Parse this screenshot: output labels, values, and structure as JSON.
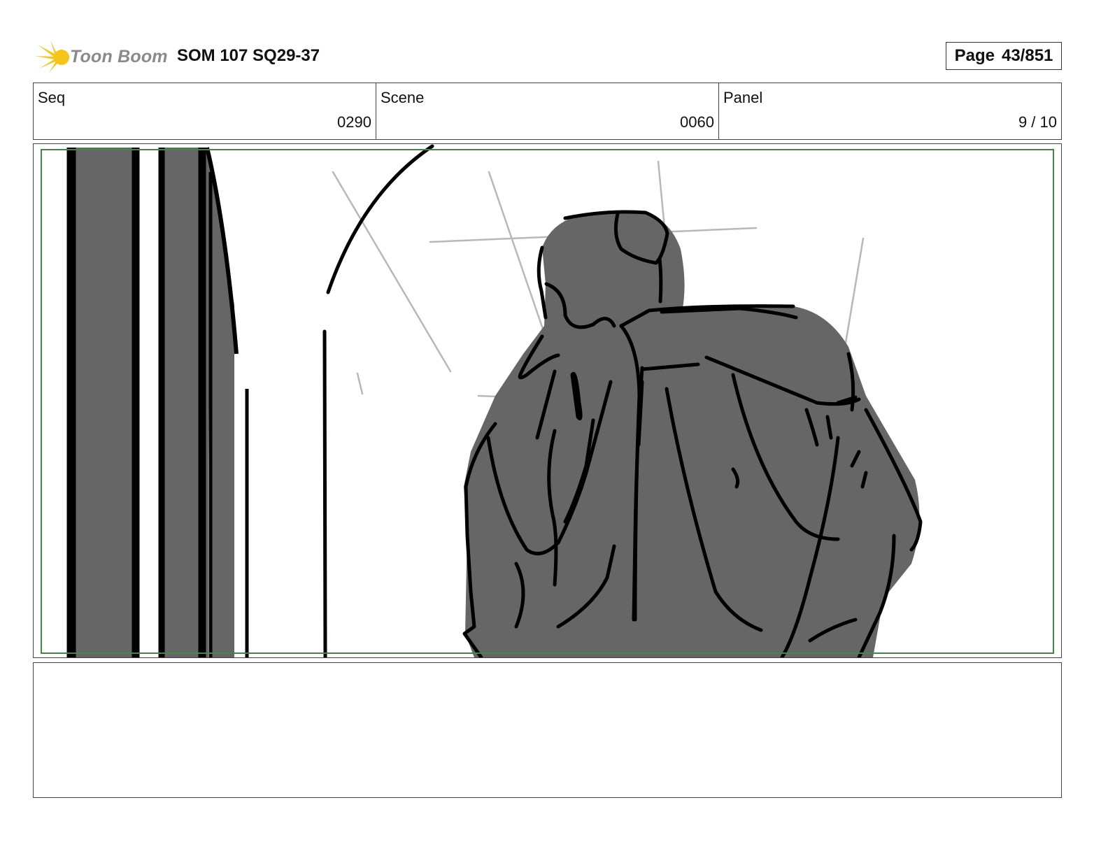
{
  "header": {
    "logo_text": "Toon Boom",
    "title": "SOM 107 SQ29-37",
    "page_label": "Page",
    "page_value": "43/851"
  },
  "info": {
    "seq": {
      "label": "Seq",
      "value": "0290"
    },
    "scene": {
      "label": "Scene",
      "value": "0060"
    },
    "panel": {
      "label": "Panel",
      "value": "9 / 10"
    }
  },
  "colors": {
    "logo_yellow": "#f5c518",
    "logo_text": "#8a8a8a",
    "sketch_fill": "#666666",
    "safe_area": "#3f8a3f"
  },
  "notes": {
    "text": ""
  }
}
